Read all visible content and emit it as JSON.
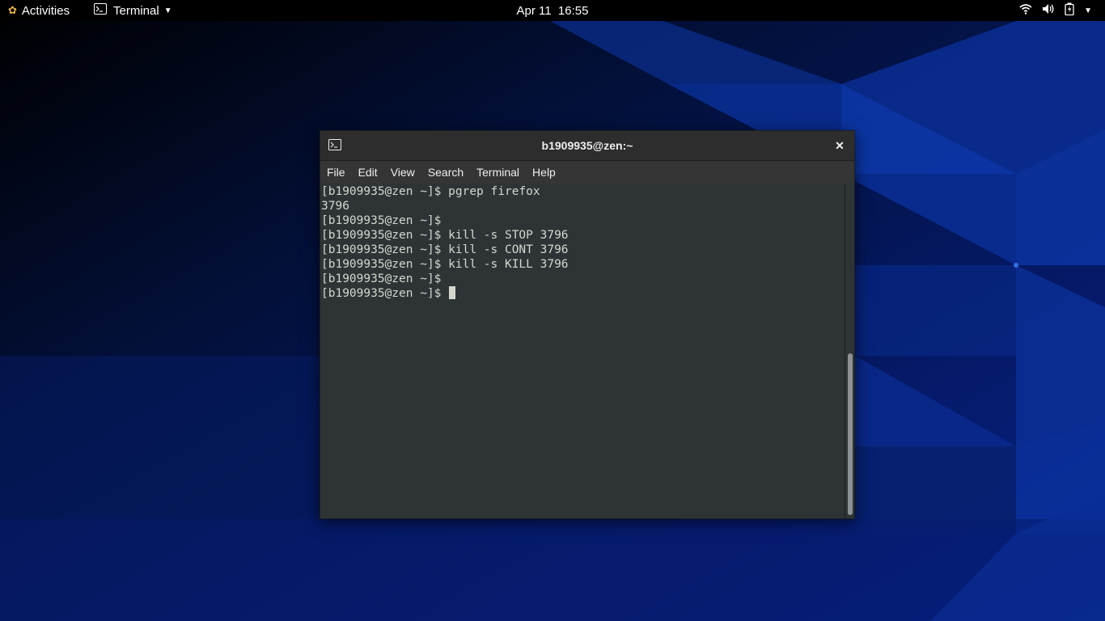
{
  "topbar": {
    "activities_label": "Activities",
    "app_menu_label": "Terminal",
    "clock": "Apr 11  16:55",
    "tray_icons": [
      "wifi-icon",
      "volume-icon",
      "battery-icon",
      "system-menu-caret-icon"
    ]
  },
  "window": {
    "title": "b1909935@zen:~",
    "menu": [
      "File",
      "Edit",
      "View",
      "Search",
      "Terminal",
      "Help"
    ]
  },
  "terminal": {
    "lines": [
      "[b1909935@zen ~]$ pgrep firefox",
      "3796",
      "[b1909935@zen ~]$",
      "[b1909935@zen ~]$ kill -s STOP 3796",
      "[b1909935@zen ~]$ kill -s CONT 3796",
      "[b1909935@zen ~]$ kill -s KILL 3796",
      "[b1909935@zen ~]$",
      "[b1909935@zen ~]$ "
    ]
  },
  "colors": {
    "topbar_bg": "#000000",
    "terminal_bg": "#2e3436",
    "terminal_fg": "#d3d7cf",
    "wallpaper_base": "#041447",
    "wallpaper_accent": "#0b3a9a"
  }
}
